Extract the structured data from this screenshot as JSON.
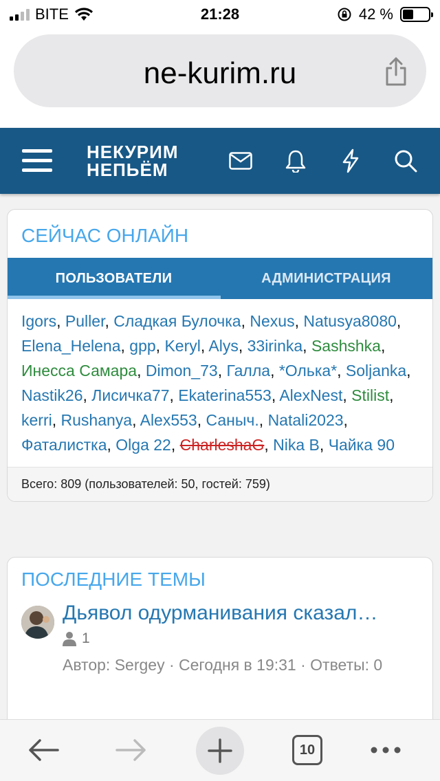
{
  "status_bar": {
    "carrier": "BITE",
    "time": "21:28",
    "battery_percent": "42 %",
    "battery_level": 0.42
  },
  "browser": {
    "url": "ne-kurim.ru"
  },
  "site": {
    "logo_line1": "НЕКУРИМ",
    "logo_line2": "НЕПЬЁМ",
    "header_bg": "#185886"
  },
  "online": {
    "title": "СЕЙЧАС ОНЛАЙН",
    "tabs": [
      {
        "label": "ПОЛЬЗОВАТЕЛИ",
        "active": true
      },
      {
        "label": "АДМИНИСТРАЦИЯ",
        "active": false
      }
    ],
    "users": [
      {
        "name": "Igors",
        "style": "blue"
      },
      {
        "name": "Puller",
        "style": "blue"
      },
      {
        "name": "Сладкая Булочка",
        "style": "blue"
      },
      {
        "name": "Nexus",
        "style": "blue"
      },
      {
        "name": "Natusya8080",
        "style": "blue"
      },
      {
        "name": "Elena_Helena",
        "style": "blue"
      },
      {
        "name": "gpp",
        "style": "blue"
      },
      {
        "name": "Keryl",
        "style": "blue"
      },
      {
        "name": "Alys",
        "style": "blue"
      },
      {
        "name": "33irinka",
        "style": "blue"
      },
      {
        "name": "Sashshka",
        "style": "green"
      },
      {
        "name": "Инесса Самара",
        "style": "green"
      },
      {
        "name": "Dimon_73",
        "style": "blue"
      },
      {
        "name": "Галла",
        "style": "blue"
      },
      {
        "name": "*Олька*",
        "style": "blue"
      },
      {
        "name": "Soljanka",
        "style": "blue"
      },
      {
        "name": "Nastik26",
        "style": "blue"
      },
      {
        "name": "Лисичка77",
        "style": "blue"
      },
      {
        "name": "Ekaterina553",
        "style": "blue"
      },
      {
        "name": "AlexNest",
        "style": "blue"
      },
      {
        "name": "Stilist",
        "style": "green"
      },
      {
        "name": "kerri",
        "style": "blue"
      },
      {
        "name": "Rushanya",
        "style": "blue"
      },
      {
        "name": "Alex553",
        "style": "blue"
      },
      {
        "name": "Саныч.",
        "style": "blue"
      },
      {
        "name": "Natali2023",
        "style": "blue"
      },
      {
        "name": "Фаталистка",
        "style": "blue"
      },
      {
        "name": "Olga 22",
        "style": "blue"
      },
      {
        "name": "CharleshaG",
        "style": "banned"
      },
      {
        "name": "Nika B",
        "style": "blue"
      },
      {
        "name": "Чайка 90",
        "style": "blue"
      }
    ],
    "footer": "Всего: 809 (пользователей: 50, гостей: 759)"
  },
  "latest": {
    "title": "ПОСЛЕДНИЕ ТЕМЫ",
    "threads": [
      {
        "title": "Дьявол одурманивания сказал…",
        "replies_icon": "user-icon",
        "participants": "1",
        "meta": "Автор: Sergey · Сегодня в 19:31 · Ответы: 0"
      }
    ]
  },
  "toolbar": {
    "tab_count": "10"
  },
  "colors": {
    "accent": "#2577b1",
    "title_blue": "#47a7eb",
    "green_user": "#2e8b3d",
    "banned_user": "#c22"
  }
}
